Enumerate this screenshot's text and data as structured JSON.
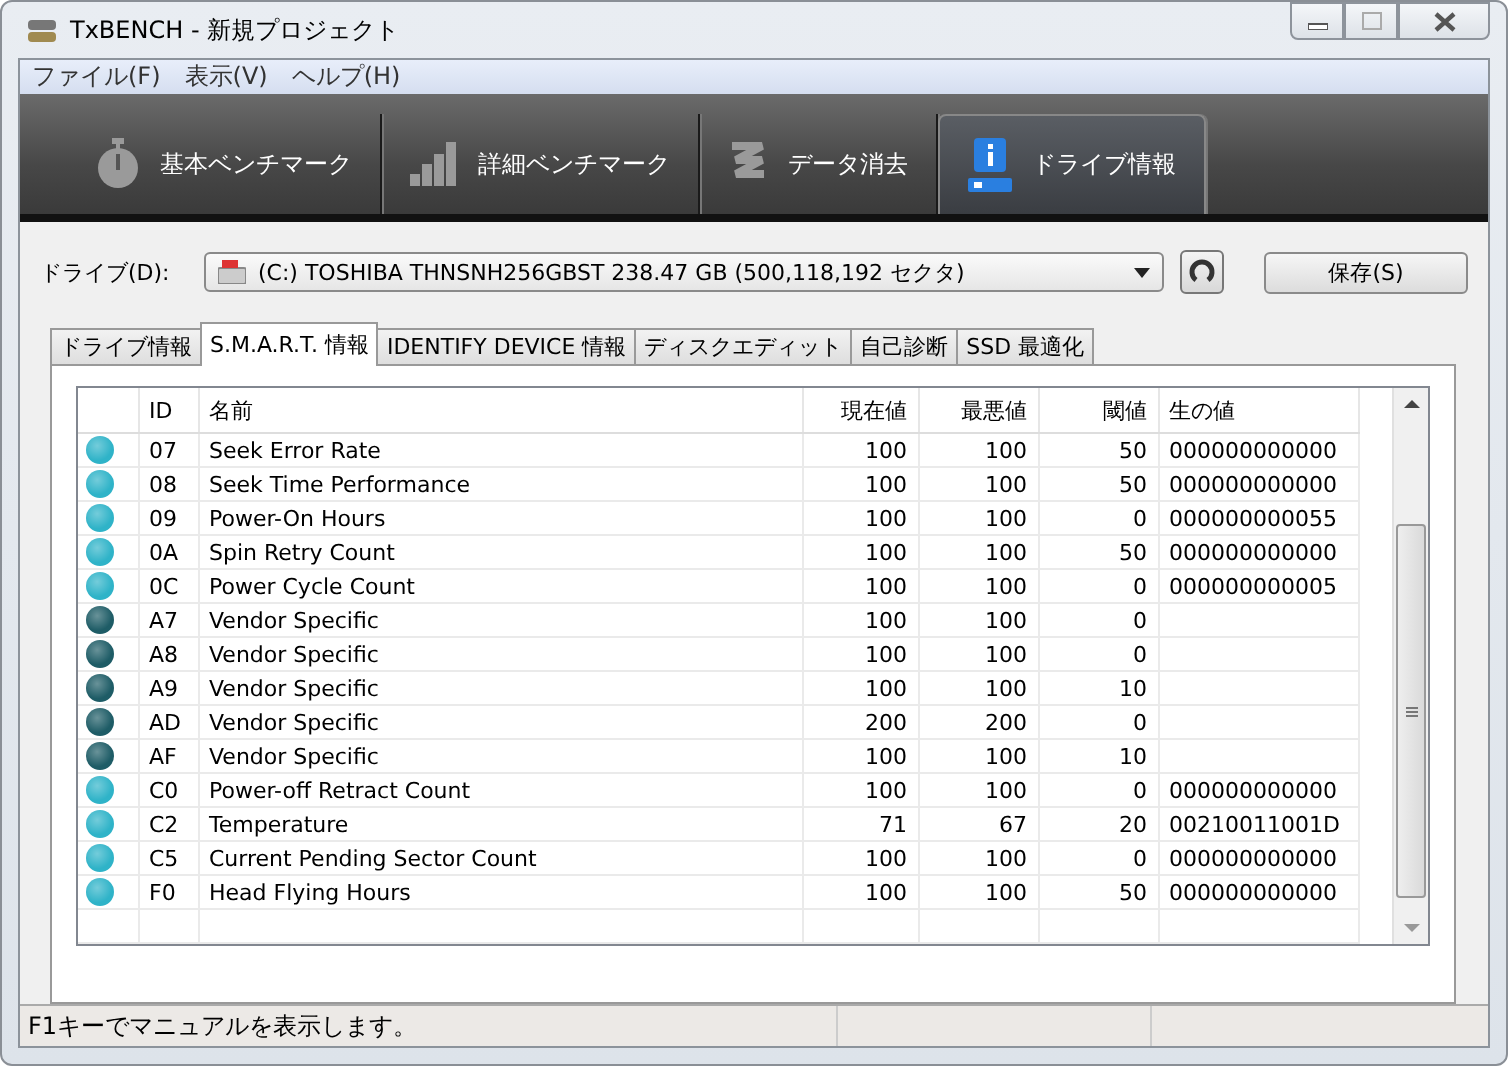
{
  "window": {
    "title": "TxBENCH - 新規プロジェクト"
  },
  "menu": [
    "ファイル(F)",
    "表示(V)",
    "ヘルプ(H)"
  ],
  "toolbar": [
    {
      "label": "基本ベンチマーク",
      "kind": "stopwatch",
      "selected": false
    },
    {
      "label": "詳細ベンチマーク",
      "kind": "bars",
      "selected": false
    },
    {
      "label": "データ消去",
      "kind": "zigzag",
      "selected": false
    },
    {
      "label": "ドライブ情報",
      "kind": "drive",
      "selected": true
    }
  ],
  "drive": {
    "label": "ドライブ(D):",
    "value": "(C:) TOSHIBA THNSNH256GBST  238.47 GB (500,118,192 セクタ)",
    "save": "保存(S)"
  },
  "tabs": [
    {
      "label": "ドライブ情報",
      "selected": false
    },
    {
      "label": "S.M.A.R.T. 情報",
      "selected": true
    },
    {
      "label": "IDENTIFY DEVICE 情報",
      "selected": false
    },
    {
      "label": "ディスクエディット",
      "selected": false
    },
    {
      "label": "自己診断",
      "selected": false
    },
    {
      "label": "SSD 最適化",
      "selected": false
    }
  ],
  "table": {
    "columns": [
      "ID",
      "名前",
      "現在値",
      "最悪値",
      "閾値",
      "生の値"
    ],
    "rows": [
      {
        "color": "#2fb3c8",
        "id": "07",
        "name": "Seek Error Rate",
        "current": "100",
        "worst": "100",
        "threshold": "50",
        "raw": "000000000000"
      },
      {
        "color": "#2fb3c8",
        "id": "08",
        "name": "Seek Time Performance",
        "current": "100",
        "worst": "100",
        "threshold": "50",
        "raw": "000000000000"
      },
      {
        "color": "#2fb3c8",
        "id": "09",
        "name": "Power-On Hours",
        "current": "100",
        "worst": "100",
        "threshold": "0",
        "raw": "000000000055"
      },
      {
        "color": "#2fb3c8",
        "id": "0A",
        "name": "Spin Retry Count",
        "current": "100",
        "worst": "100",
        "threshold": "50",
        "raw": "000000000000"
      },
      {
        "color": "#2fb3c8",
        "id": "0C",
        "name": "Power Cycle Count",
        "current": "100",
        "worst": "100",
        "threshold": "0",
        "raw": "000000000005"
      },
      {
        "color": "#1e5c66",
        "id": "A7",
        "name": "Vendor Specific",
        "current": "100",
        "worst": "100",
        "threshold": "0"
      },
      {
        "color": "#1e5c66",
        "id": "A8",
        "name": "Vendor Specific",
        "current": "100",
        "worst": "100",
        "threshold": "0"
      },
      {
        "color": "#1e5c66",
        "id": "A9",
        "name": "Vendor Specific",
        "current": "100",
        "worst": "100",
        "threshold": "10"
      },
      {
        "color": "#1e5c66",
        "id": "AD",
        "name": "Vendor Specific",
        "current": "200",
        "worst": "200",
        "threshold": "0"
      },
      {
        "color": "#1e5c66",
        "id": "AF",
        "name": "Vendor Specific",
        "current": "100",
        "worst": "100",
        "threshold": "10"
      },
      {
        "color": "#2fb3c8",
        "id": "C0",
        "name": "Power-off Retract Count",
        "current": "100",
        "worst": "100",
        "threshold": "0",
        "raw": "000000000000"
      },
      {
        "color": "#2fb3c8",
        "id": "C2",
        "name": "Temperature",
        "current": "71",
        "worst": "67",
        "threshold": "20",
        "raw": "00210011001D"
      },
      {
        "color": "#2fb3c8",
        "id": "C5",
        "name": "Current Pending Sector Count",
        "current": "100",
        "worst": "100",
        "threshold": "0",
        "raw": "000000000000"
      },
      {
        "color": "#2fb3c8",
        "id": "F0",
        "name": "Head Flying Hours",
        "current": "100",
        "worst": "100",
        "threshold": "50",
        "raw": "000000000000"
      }
    ]
  },
  "status_bar": "F1キーでマニュアルを表示します。"
}
